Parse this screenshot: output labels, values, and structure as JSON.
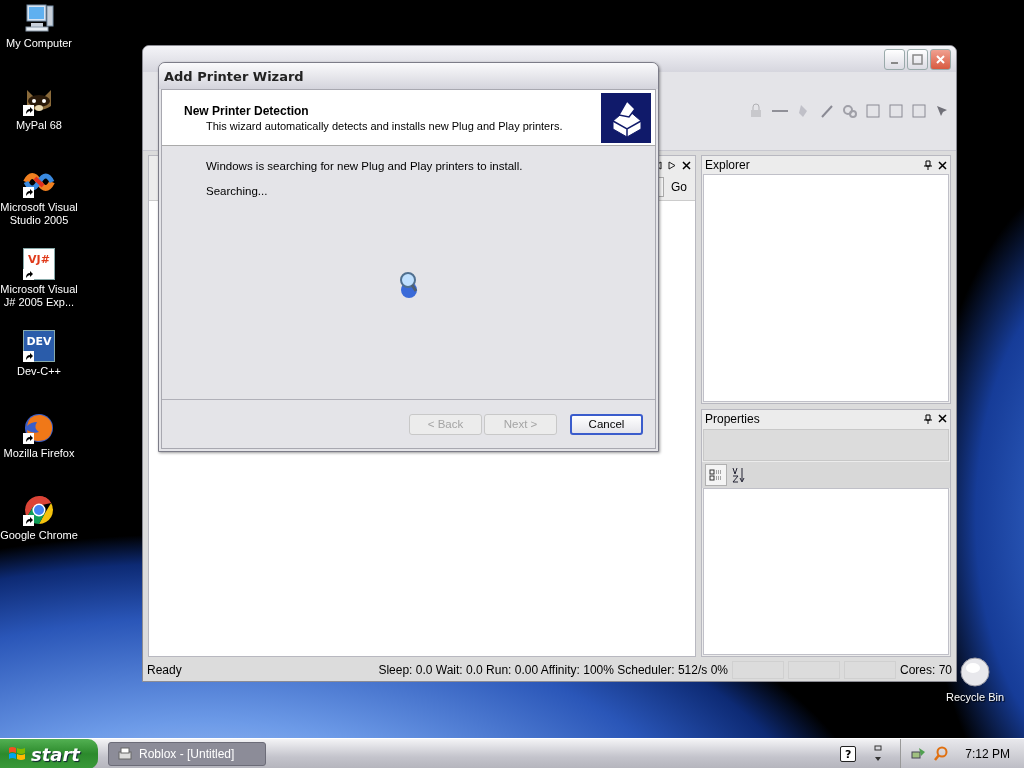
{
  "desktop": {
    "icons": [
      {
        "label": "My Computer",
        "shortcut": false
      },
      {
        "label": "MyPal 68",
        "shortcut": true
      },
      {
        "label": "Microsoft Visual Studio 2005",
        "shortcut": true
      },
      {
        "label": "Microsoft Visual J# 2005 Exp...",
        "shortcut": true,
        "logo_text": "VJ#"
      },
      {
        "label": "Dev-C++",
        "shortcut": true,
        "logo_text": "DEV"
      },
      {
        "label": "Mozilla Firefox",
        "shortcut": true
      },
      {
        "label": "Google Chrome",
        "shortcut": true
      }
    ],
    "recycle_bin": {
      "label": "Recycle Bin"
    }
  },
  "app_window": {
    "go_button": "Go",
    "explorer": {
      "title": "Explorer"
    },
    "properties": {
      "title": "Properties"
    },
    "status_bar": {
      "status": "Ready",
      "stats": "Sleep: 0.0 Wait: 0.0 Run: 0.00 Affinity: 100% Scheduler: 512/s 0%",
      "cores": "Cores: 70"
    }
  },
  "wizard": {
    "title": "Add Printer Wizard",
    "header": {
      "title": "New Printer Detection",
      "subtitle": "This wizard automatically detects and installs new Plug and Play printers."
    },
    "message": "Windows is searching for new Plug and Play printers to install.",
    "progress_text": "Searching...",
    "buttons": [
      {
        "label": "< Back",
        "disabled": true,
        "default": false
      },
      {
        "label": "Next >",
        "disabled": true,
        "default": false
      },
      {
        "label": "Cancel",
        "disabled": false,
        "default": true
      }
    ]
  },
  "taskbar": {
    "start": "start",
    "tasks": [
      {
        "label": "Roblox - [Untitled]",
        "selected": false
      }
    ],
    "help_glyph": "?",
    "clock": "7:12 PM"
  }
}
